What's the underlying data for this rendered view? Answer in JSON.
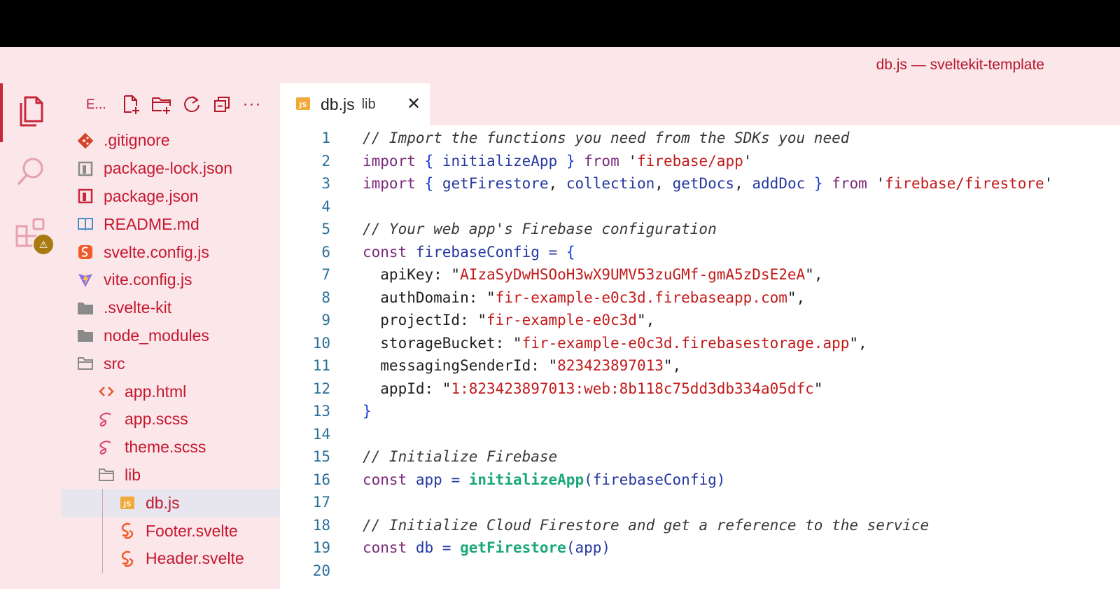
{
  "window": {
    "title": "db.js — sveltekit-template"
  },
  "activity_bar": {
    "items": [
      {
        "name": "explorer",
        "icon": "files-icon",
        "active": true
      },
      {
        "name": "search",
        "icon": "search-icon",
        "active": false
      },
      {
        "name": "extensions",
        "icon": "extensions-icon",
        "active": false,
        "badge": "⚠"
      }
    ]
  },
  "explorer": {
    "title": "E...",
    "actions": [
      {
        "name": "new-file",
        "icon": "new-file-icon"
      },
      {
        "name": "new-folder",
        "icon": "new-folder-icon"
      },
      {
        "name": "refresh",
        "icon": "refresh-icon"
      },
      {
        "name": "collapse-all",
        "icon": "collapse-icon"
      },
      {
        "name": "more",
        "icon": "more-icon",
        "glyph": "···"
      }
    ],
    "tree": [
      {
        "label": ".gitignore",
        "icon": "git-icon",
        "indent": 0
      },
      {
        "label": "package-lock.json",
        "icon": "npm-lock-icon",
        "indent": 0
      },
      {
        "label": "package.json",
        "icon": "npm-icon",
        "indent": 0
      },
      {
        "label": "README.md",
        "icon": "book-icon",
        "indent": 0
      },
      {
        "label": "svelte.config.js",
        "icon": "svelte-icon",
        "indent": 0
      },
      {
        "label": "vite.config.js",
        "icon": "vite-icon",
        "indent": 0
      },
      {
        "label": ".svelte-kit",
        "icon": "folder-filled-icon",
        "indent": 0
      },
      {
        "label": "node_modules",
        "icon": "folder-filled-icon",
        "indent": 0
      },
      {
        "label": "src",
        "icon": "folder-open-icon",
        "indent": 0
      },
      {
        "label": "app.html",
        "icon": "html-icon",
        "indent": 1
      },
      {
        "label": "app.scss",
        "icon": "sass-icon",
        "indent": 1
      },
      {
        "label": "theme.scss",
        "icon": "sass-icon",
        "indent": 1
      },
      {
        "label": "lib",
        "icon": "folder-open-icon",
        "indent": 1
      },
      {
        "label": "db.js",
        "icon": "js-icon",
        "indent": 2,
        "selected": true
      },
      {
        "label": "Footer.svelte",
        "icon": "svelte-icon",
        "indent": 2
      },
      {
        "label": "Header.svelte",
        "icon": "svelte-icon",
        "indent": 2
      }
    ]
  },
  "tab": {
    "icon_text": "JS",
    "name": "db.js",
    "description": "lib",
    "close_glyph": "✕"
  },
  "colors": {
    "accent": "#c8283a",
    "text_red": "#c4182e",
    "background": "#fbe6ea",
    "selection": "#e7e6ee",
    "badge": "#a87b12"
  },
  "code": [
    {
      "n": "1",
      "tokens": [
        {
          "t": "// Import the functions you need from the SDKs you need",
          "c": "c-comment"
        }
      ]
    },
    {
      "n": "2",
      "tokens": [
        {
          "t": "import",
          "c": "c-kw"
        },
        {
          "t": " ",
          "c": "c-punct"
        },
        {
          "t": "{",
          "c": "c-brace"
        },
        {
          "t": " initializeApp ",
          "c": "c-ident"
        },
        {
          "t": "}",
          "c": "c-brace"
        },
        {
          "t": " ",
          "c": "c-punct"
        },
        {
          "t": "from",
          "c": "c-kw"
        },
        {
          "t": " '",
          "c": "c-punct"
        },
        {
          "t": "firebase/app",
          "c": "c-str"
        },
        {
          "t": "'",
          "c": "c-punct"
        }
      ]
    },
    {
      "n": "3",
      "tokens": [
        {
          "t": "import",
          "c": "c-kw"
        },
        {
          "t": " ",
          "c": "c-punct"
        },
        {
          "t": "{",
          "c": "c-brace"
        },
        {
          "t": " getFirestore",
          "c": "c-ident"
        },
        {
          "t": ", ",
          "c": "c-punct"
        },
        {
          "t": "collection",
          "c": "c-ident"
        },
        {
          "t": ", ",
          "c": "c-punct"
        },
        {
          "t": "getDocs",
          "c": "c-ident"
        },
        {
          "t": ", ",
          "c": "c-punct"
        },
        {
          "t": "addDoc ",
          "c": "c-ident"
        },
        {
          "t": "}",
          "c": "c-brace"
        },
        {
          "t": " ",
          "c": "c-punct"
        },
        {
          "t": "from",
          "c": "c-kw"
        },
        {
          "t": " '",
          "c": "c-punct"
        },
        {
          "t": "firebase/firestore",
          "c": "c-str"
        },
        {
          "t": "'",
          "c": "c-punct"
        }
      ]
    },
    {
      "n": "4",
      "tokens": []
    },
    {
      "n": "5",
      "tokens": [
        {
          "t": "// Your web app's Firebase configuration",
          "c": "c-comment"
        }
      ]
    },
    {
      "n": "6",
      "tokens": [
        {
          "t": "const",
          "c": "c-kw"
        },
        {
          "t": " firebaseConfig ",
          "c": "c-ident"
        },
        {
          "t": "= ",
          "c": "c-ident"
        },
        {
          "t": "{",
          "c": "c-brace"
        }
      ]
    },
    {
      "n": "7",
      "tokens": [
        {
          "t": "  apiKey: \"",
          "c": "c-prop"
        },
        {
          "t": "AIzaSyDwHSOoH3wX9UMV53zuGMf-gmA5zDsE2eA",
          "c": "c-str"
        },
        {
          "t": "\",",
          "c": "c-punct"
        }
      ]
    },
    {
      "n": "8",
      "tokens": [
        {
          "t": "  authDomain: \"",
          "c": "c-prop"
        },
        {
          "t": "fir-example-e0c3d.firebaseapp.com",
          "c": "c-str"
        },
        {
          "t": "\",",
          "c": "c-punct"
        }
      ]
    },
    {
      "n": "9",
      "tokens": [
        {
          "t": "  projectId: \"",
          "c": "c-prop"
        },
        {
          "t": "fir-example-e0c3d",
          "c": "c-str"
        },
        {
          "t": "\",",
          "c": "c-punct"
        }
      ]
    },
    {
      "n": "10",
      "tokens": [
        {
          "t": "  storageBucket: \"",
          "c": "c-prop"
        },
        {
          "t": "fir-example-e0c3d.firebasestorage.app",
          "c": "c-str"
        },
        {
          "t": "\",",
          "c": "c-punct"
        }
      ]
    },
    {
      "n": "11",
      "tokens": [
        {
          "t": "  messagingSenderId: \"",
          "c": "c-prop"
        },
        {
          "t": "823423897013",
          "c": "c-str"
        },
        {
          "t": "\",",
          "c": "c-punct"
        }
      ]
    },
    {
      "n": "12",
      "tokens": [
        {
          "t": "  appId: \"",
          "c": "c-prop"
        },
        {
          "t": "1:823423897013:web:8b118c75dd3db334a05dfc",
          "c": "c-str"
        },
        {
          "t": "\"",
          "c": "c-punct"
        }
      ]
    },
    {
      "n": "13",
      "tokens": [
        {
          "t": "}",
          "c": "c-brace"
        }
      ]
    },
    {
      "n": "14",
      "tokens": []
    },
    {
      "n": "15",
      "tokens": [
        {
          "t": "// Initialize Firebase",
          "c": "c-comment"
        }
      ]
    },
    {
      "n": "16",
      "tokens": [
        {
          "t": "const",
          "c": "c-kw"
        },
        {
          "t": " app ",
          "c": "c-ident"
        },
        {
          "t": "= ",
          "c": "c-ident"
        },
        {
          "t": "initializeApp",
          "c": "c-fn"
        },
        {
          "t": "(firebaseConfig)",
          "c": "c-ident"
        }
      ]
    },
    {
      "n": "17",
      "tokens": []
    },
    {
      "n": "18",
      "tokens": [
        {
          "t": "// Initialize Cloud Firestore and get a reference to the service",
          "c": "c-comment"
        }
      ]
    },
    {
      "n": "19",
      "tokens": [
        {
          "t": "const",
          "c": "c-kw"
        },
        {
          "t": " db ",
          "c": "c-ident"
        },
        {
          "t": "= ",
          "c": "c-ident"
        },
        {
          "t": "getFirestore",
          "c": "c-fn"
        },
        {
          "t": "(app)",
          "c": "c-ident"
        }
      ]
    },
    {
      "n": "20",
      "tokens": []
    }
  ]
}
